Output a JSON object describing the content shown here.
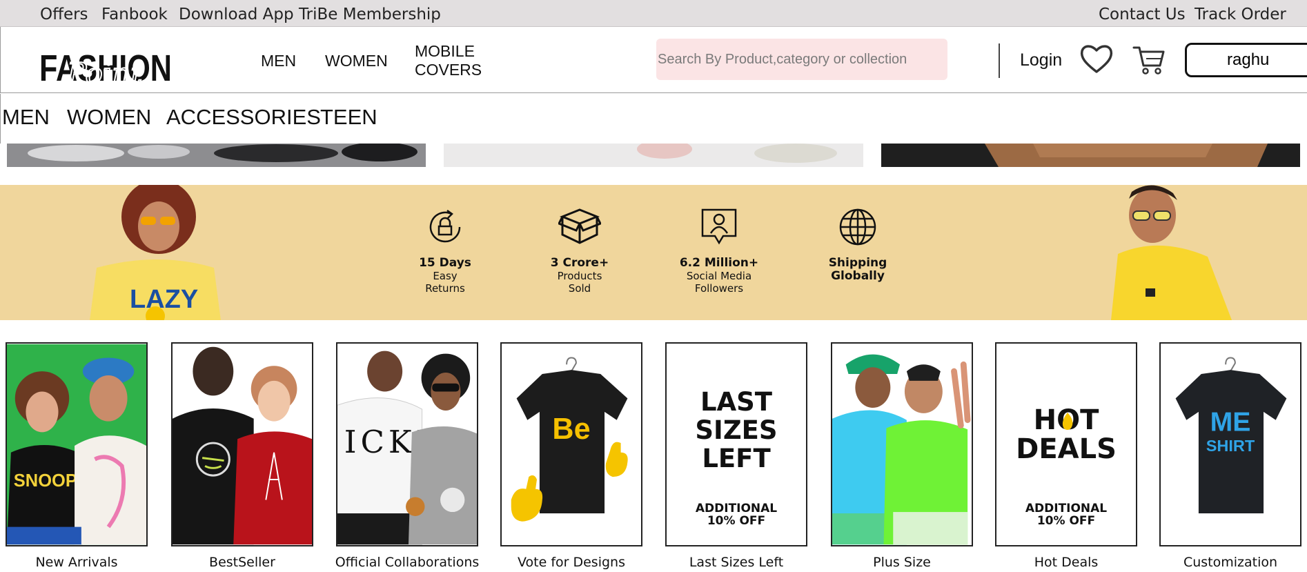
{
  "topbar": {
    "offers": "Offers",
    "fanbook": "Fanbook",
    "download_app": "Download App",
    "membership": "TriBe Membership",
    "contact": "Contact Us",
    "track": "Track Order"
  },
  "header": {
    "logo_main": "FASHION",
    "logo_script": "Point",
    "nav": [
      "MEN",
      "WOMEN",
      "MOBILE",
      "COVERS"
    ],
    "search_placeholder": "Search By Product,category or collection",
    "login": "Login",
    "user": "raghu"
  },
  "category_nav": [
    "MEN",
    "WOMEN",
    "ACCESSORIES",
    "TEEN"
  ],
  "features": [
    {
      "title": "15 Days",
      "sub1": "Easy",
      "sub2": "Returns",
      "icon": "return-icon"
    },
    {
      "title": "3 Crore+",
      "sub1": "Products",
      "sub2": "Sold",
      "icon": "box-icon"
    },
    {
      "title": "6.2 Million+",
      "sub1": "Social Media",
      "sub2": "Followers",
      "icon": "follower-icon"
    },
    {
      "title": "Shipping",
      "sub1": "Globally",
      "sub2": "",
      "icon": "globe-icon"
    }
  ],
  "cards": [
    {
      "label": "New Arrivals"
    },
    {
      "label": "BestSeller"
    },
    {
      "label": "Official Collaborations",
      "print": "ICKF"
    },
    {
      "label": "Vote for Designs",
      "print": "Be"
    },
    {
      "label": "Last Sizes Left",
      "l1": "LAST",
      "l2": "SIZES",
      "l3": "LEFT",
      "o1": "ADDITIONAL",
      "o2": "10% OFF"
    },
    {
      "label": "Plus Size"
    },
    {
      "label": "Hot Deals",
      "l1": "HOT",
      "l2": "DEALS",
      "o1": "ADDITIONAL",
      "o2": "10% OFF"
    },
    {
      "label": "Customization",
      "p1": "ME",
      "p2": "SHIRT"
    }
  ],
  "colors": {
    "topbar": "#e2dfe0",
    "banner": "#f0d69c",
    "search_bg": "#fbe4e5",
    "accent_yellow": "#f5c400"
  }
}
